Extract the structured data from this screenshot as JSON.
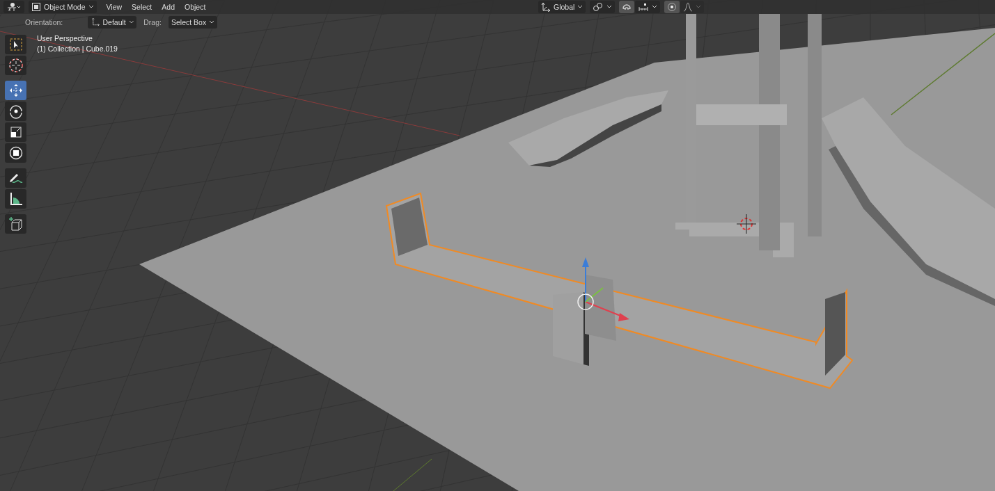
{
  "header": {
    "mode": {
      "label": "Object Mode"
    },
    "menus": [
      "View",
      "Select",
      "Add",
      "Object"
    ],
    "transform": {
      "label": "Global"
    },
    "snap": {
      "on": true
    },
    "proportional": {
      "on": true
    }
  },
  "tool_settings": {
    "orientation_label": "Orientation:",
    "orientation": {
      "label": "Default"
    },
    "drag_label": "Drag:",
    "drag": {
      "label": "Select Box"
    }
  },
  "toolbar": [
    [
      {
        "kind": "select-box",
        "selected": false
      },
      {
        "kind": "cursor",
        "selected": false
      }
    ],
    [
      {
        "kind": "move",
        "selected": true
      },
      {
        "kind": "rotate",
        "selected": false
      },
      {
        "kind": "scale",
        "selected": false
      },
      {
        "kind": "transform",
        "selected": false
      }
    ],
    [
      {
        "kind": "annotate",
        "selected": false
      },
      {
        "kind": "measure",
        "selected": false
      }
    ],
    [
      {
        "kind": "add-cube",
        "selected": false
      }
    ]
  ],
  "viewport": {
    "perspective": "User Perspective",
    "object": "(1) Collection | Cube.019"
  }
}
